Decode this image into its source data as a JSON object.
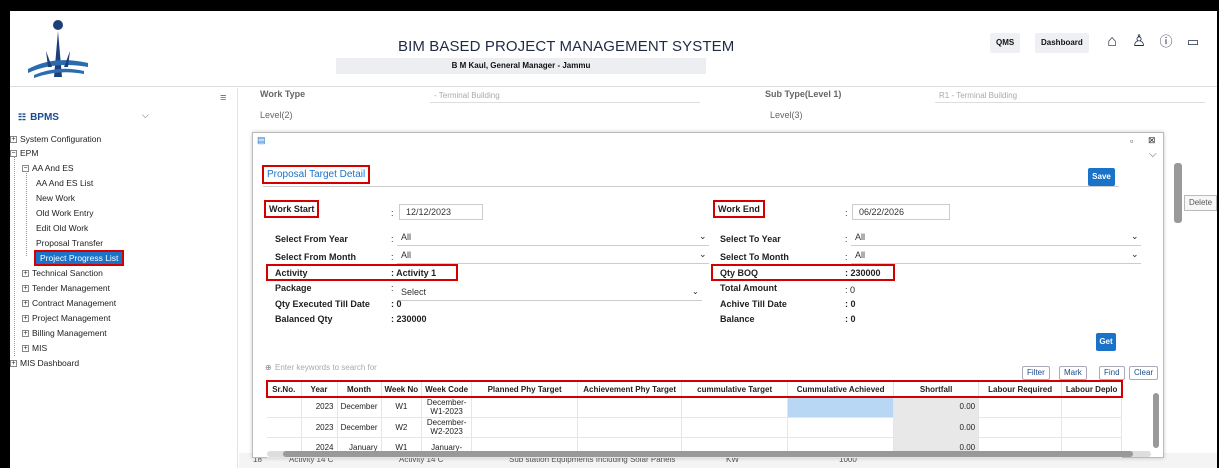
{
  "header": {
    "title": "BIM BASED PROJECT MANAGEMENT SYSTEM",
    "subtitle": "B M Kaul, General Manager - Jammu",
    "qms": "QMS",
    "dashboard": "Dashboard"
  },
  "sidebar": {
    "title": "BPMS",
    "items": [
      "System Configuration",
      "EPM",
      "AA And ES",
      "AA And ES List",
      "New Work",
      "Old Work Entry",
      "Edit Old Work",
      "Proposal Transfer",
      "Project Progress List",
      "Technical Sanction",
      "Tender Management",
      "Contract Management",
      "Project Management",
      "Billing Management",
      "MIS",
      "MIS Dashboard"
    ]
  },
  "background": {
    "work_type_label": "Work Type",
    "work_type_value": "- Terminal Building",
    "sub_type_label": "Sub Type(Level 1)",
    "sub_type_value": "R1 - Terminal Building",
    "level2_label": "Level(2)",
    "level3_label": "Level(3)",
    "delete_btn": "Delete",
    "bottom_row": {
      "no": "18",
      "activity": "Activity 14 C",
      "activity2": "Activity 14 C",
      "desc": "Sub station Equipments Including Solar Panels",
      "unit": "KW",
      "qty": "1000"
    }
  },
  "modal": {
    "title": "Proposal Target Detail",
    "save": "Save",
    "work_start_label": "Work Start",
    "work_start_value": "12/12/2023",
    "work_end_label": "Work End",
    "work_end_value": "06/22/2026",
    "from_year_label": "Select From Year",
    "from_year_value": "All",
    "to_year_label": "Select To Year",
    "to_year_value": "All",
    "from_month_label": "Select From Month",
    "from_month_value": "All",
    "to_month_label": "Select To Month",
    "to_month_value": "All",
    "activity_label": "Activity",
    "activity_value": ": Activity 1",
    "qty_boq_label": "Qty BOQ",
    "qty_boq_value": ": 230000",
    "package_label": "Package",
    "package_value": "Select",
    "total_amount_label": "Total Amount",
    "total_amount_value": ": 0",
    "qty_exec_label": "Qty Executed Till Date",
    "qty_exec_value": ": 0",
    "achive_label": "Achive Till Date",
    "achive_value": ": 0",
    "balanced_label": "Balanced Qty",
    "balanced_value": ": 230000",
    "balance_label": "Balance",
    "balance_value": ": 0",
    "get": "Get",
    "search_placeholder": "Enter keywords to search for",
    "filter": "Filter",
    "mark": "Mark",
    "find": "Find",
    "clear": "Clear",
    "columns": [
      "Sr.No.",
      "Year",
      "Month",
      "Week No",
      "Week Code",
      "Planned Phy Target",
      "Achievement Phy Target",
      "cummulative Target",
      "Cummulative Achieved",
      "Shortfall",
      "Labour Required",
      "Labour Deplo"
    ],
    "rows": [
      {
        "year": "2023",
        "month": "December",
        "week": "W1",
        "code": "December-W1-2023",
        "shortfall": "0.00"
      },
      {
        "year": "2023",
        "month": "December",
        "week": "W2",
        "code": "December-W2-2023",
        "shortfall": "0.00"
      },
      {
        "year": "2024",
        "month": "January",
        "week": "W1",
        "code": "January-",
        "shortfall": "0.00"
      }
    ]
  }
}
